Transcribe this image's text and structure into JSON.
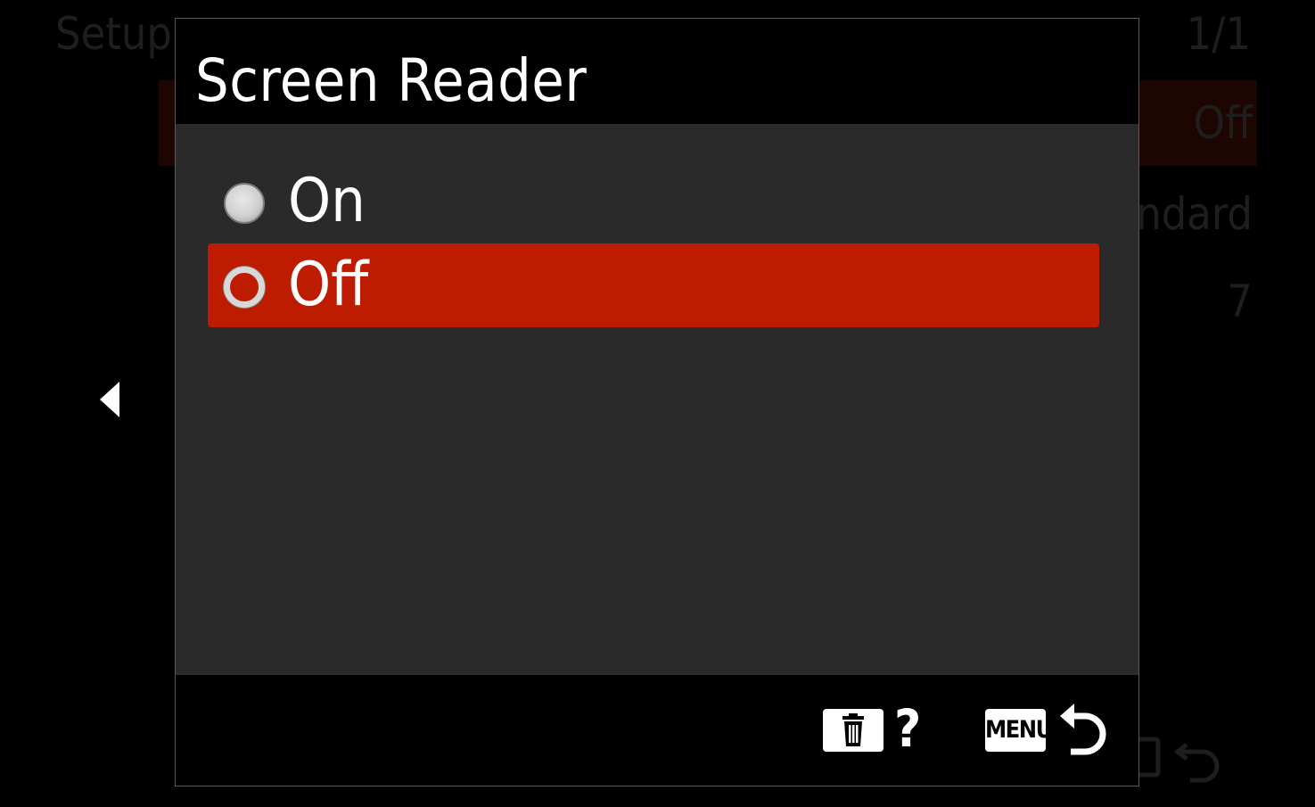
{
  "background_menu": {
    "title": "Setup",
    "page_indicator": "1/1",
    "rows": [
      {
        "value": "Off"
      },
      {
        "value": "ndard"
      },
      {
        "value": "7"
      }
    ]
  },
  "dialog": {
    "title": "Screen Reader",
    "options": [
      {
        "label": "On",
        "selected": false
      },
      {
        "label": "Off",
        "selected": true
      }
    ],
    "footer": {
      "delete_icon": "trash-icon",
      "help_label": "?",
      "menu_key_label": "MENU",
      "back_icon": "return-arrow-icon"
    }
  },
  "colors": {
    "selection": "#be1c00",
    "dialog_body": "#2a2a2a",
    "header_footer": "#000000",
    "text": "#ffffff"
  }
}
